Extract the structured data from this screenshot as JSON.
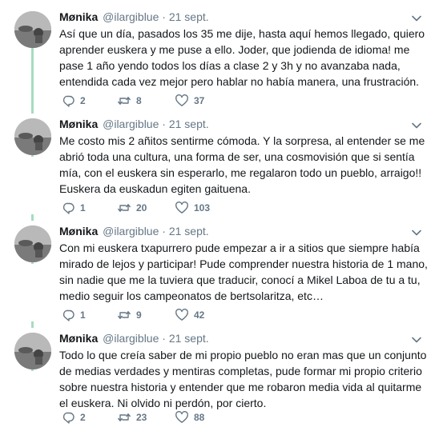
{
  "tweets": [
    {
      "name": "Mønika",
      "handle": "@ilargiblue",
      "separator": "·",
      "date": "21 sept.",
      "text": "Así que un día, pasados los 35 me dije, hasta aquí hemos llegado, quiero aprender euskera y me puse a ello. Joder, que jodienda de idioma! me pase 1 año yendo todos los días a clase 2 y 3h y no avanzaba nada, entendida cada vez mejor pero hablar no había manera, una frustración.",
      "replies": "2",
      "retweets": "8",
      "likes": "37"
    },
    {
      "name": "Mønika",
      "handle": "@ilargiblue",
      "separator": "·",
      "date": "21 sept.",
      "text": "Me costo mis 2 añitos sentirme cómoda. Y la sorpresa, al entender se me abrió toda una cultura, una forma de ser, una cosmovisión que si sentía mía, con el euskera sin esperarlo, me regalaron todo un pueblo, arraigo!! Euskera da euskadun egiten gaituena.",
      "replies": "1",
      "retweets": "20",
      "likes": "103"
    },
    {
      "name": "Mønika",
      "handle": "@ilargiblue",
      "separator": "·",
      "date": "21 sept.",
      "text": "Con mi euskera txapurrero pude empezar a ir a sitios que siempre había mirado de lejos y participar! Pude comprender nuestra historia de 1 mano, sin nadie que me la tuviera que traducir, conocí a Mikel Laboa de tu a tu, medio seguir los campeonatos de bertsolaritza, etc…",
      "replies": "1",
      "retweets": "9",
      "likes": "42"
    },
    {
      "name": "Mønika",
      "handle": "@ilargiblue",
      "separator": "·",
      "date": "21 sept.",
      "text": "Todo lo que creía saber de mi propio pueblo no eran mas que un conjunto de medias verdades y mentiras completas, pude formar mi propio criterio sobre nuestra historia y entender que me robaron media vida al quitarme el euskera. Ni olvido ni perdón, por cierto.",
      "replies": "2",
      "retweets": "23",
      "likes": "88"
    }
  ],
  "icons": {
    "reply": "reply-icon",
    "retweet": "retweet-icon",
    "like": "heart-icon",
    "menu": "chevron-down-icon"
  },
  "colors": {
    "thread_line": "#a5ddbf",
    "secondary_text": "#657786",
    "primary_text": "#14171a"
  }
}
